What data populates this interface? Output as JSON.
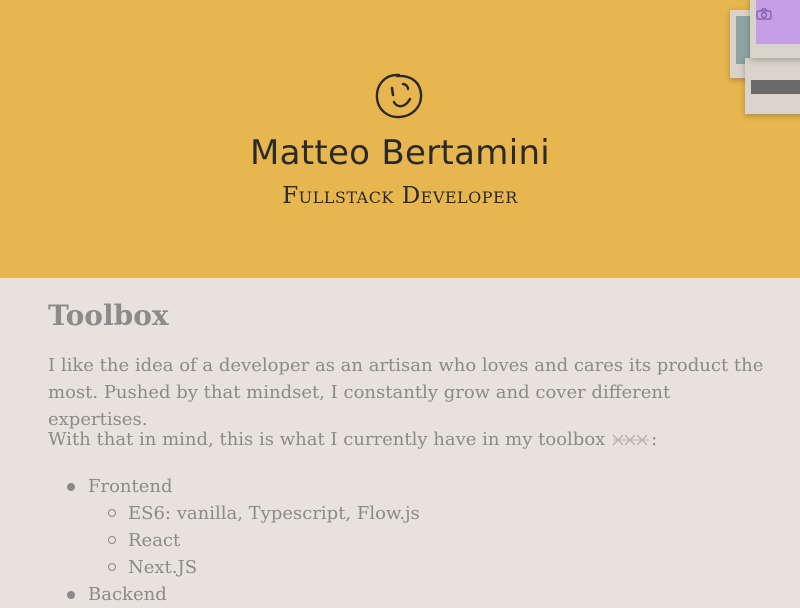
{
  "header": {
    "name": "Matteo Bertamini",
    "role": "Fullstack Developer",
    "avatar_icon": "smiley-face-icon",
    "background_color": "#e8b64f"
  },
  "photos": {
    "icon": "camera-icon"
  },
  "toolbox": {
    "title": "Toolbox",
    "intro": "I like the idea of a developer as an artisan who loves and cares its product the most. Pushed by that mindset, I constantly grow and cover different expertises.",
    "lead_text": "With that in mind, this is what I currently have in my toolbox",
    "lead_suffix": ":",
    "tools_icon": "tools-icon",
    "categories": [
      {
        "label": "Frontend",
        "items": [
          "ES6: vanilla, Typescript, Flow.js",
          "React",
          "Next.JS"
        ]
      },
      {
        "label": "Backend",
        "items": []
      }
    ]
  },
  "colors": {
    "page_background": "#e8e2dc",
    "text": "#8a8a8a",
    "heading": "#2a2a2a"
  }
}
